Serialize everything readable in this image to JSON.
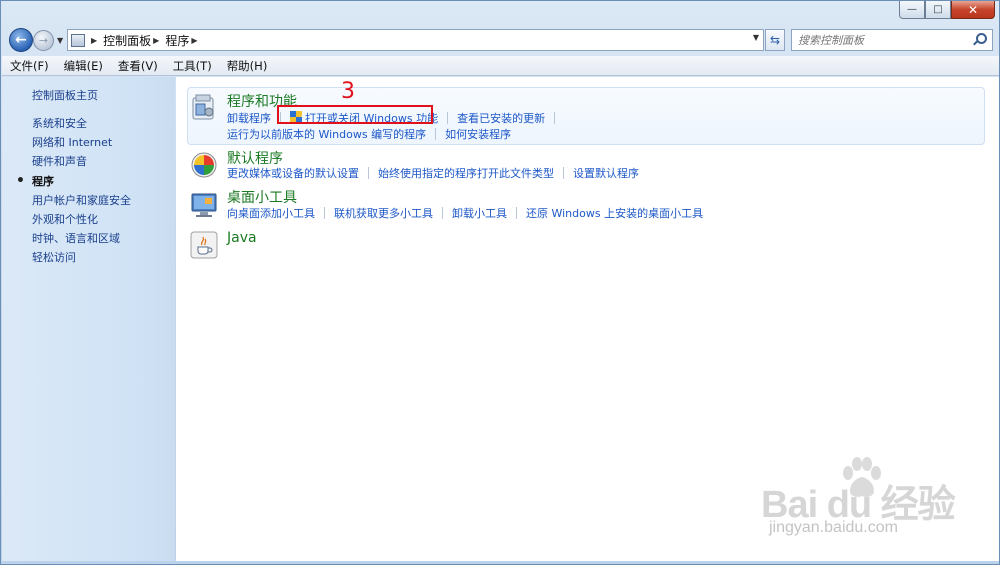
{
  "window": {
    "min_glyph": "—",
    "max_glyph": "□",
    "close_glyph": "✕"
  },
  "address": {
    "crumbs": [
      "控制面板",
      "程序"
    ],
    "search_placeholder": "搜索控制面板"
  },
  "menubar": [
    "文件(F)",
    "编辑(E)",
    "查看(V)",
    "工具(T)",
    "帮助(H)"
  ],
  "sidebar": {
    "home": "控制面板主页",
    "items": [
      {
        "label": "系统和安全",
        "active": false
      },
      {
        "label": "网络和 Internet",
        "active": false
      },
      {
        "label": "硬件和声音",
        "active": false
      },
      {
        "label": "程序",
        "active": true
      },
      {
        "label": "用户帐户和家庭安全",
        "active": false
      },
      {
        "label": "外观和个性化",
        "active": false
      },
      {
        "label": "时钟、语言和区域",
        "active": false
      },
      {
        "label": "轻松访问",
        "active": false
      }
    ]
  },
  "categories": [
    {
      "title": "程序和功能",
      "icon": "programs-features-icon",
      "links": [
        [
          "卸载程序",
          "打开或关闭 Windows 功能",
          "查看已安装的更新"
        ],
        [
          "运行为以前版本的 Windows 编写的程序",
          "如何安装程序"
        ]
      ]
    },
    {
      "title": "默认程序",
      "icon": "default-programs-icon",
      "links": [
        [
          "更改媒体或设备的默认设置",
          "始终使用指定的程序打开此文件类型",
          "设置默认程序"
        ]
      ]
    },
    {
      "title": "桌面小工具",
      "icon": "desktop-gadgets-icon",
      "links": [
        [
          "向桌面添加小工具",
          "联机获取更多小工具",
          "卸载小工具",
          "还原 Windows 上安装的桌面小工具"
        ]
      ]
    },
    {
      "title": "Java",
      "icon": "java-icon",
      "links": []
    }
  ],
  "annotation": {
    "number": "3",
    "color": "#e0111b"
  },
  "watermark": {
    "logo": "Bai du 经验",
    "url": "jingyan.baidu.com"
  },
  "colors": {
    "link": "#1d58c8",
    "category_title": "#1b7a23",
    "sidebar_link": "#1a3f8c"
  }
}
